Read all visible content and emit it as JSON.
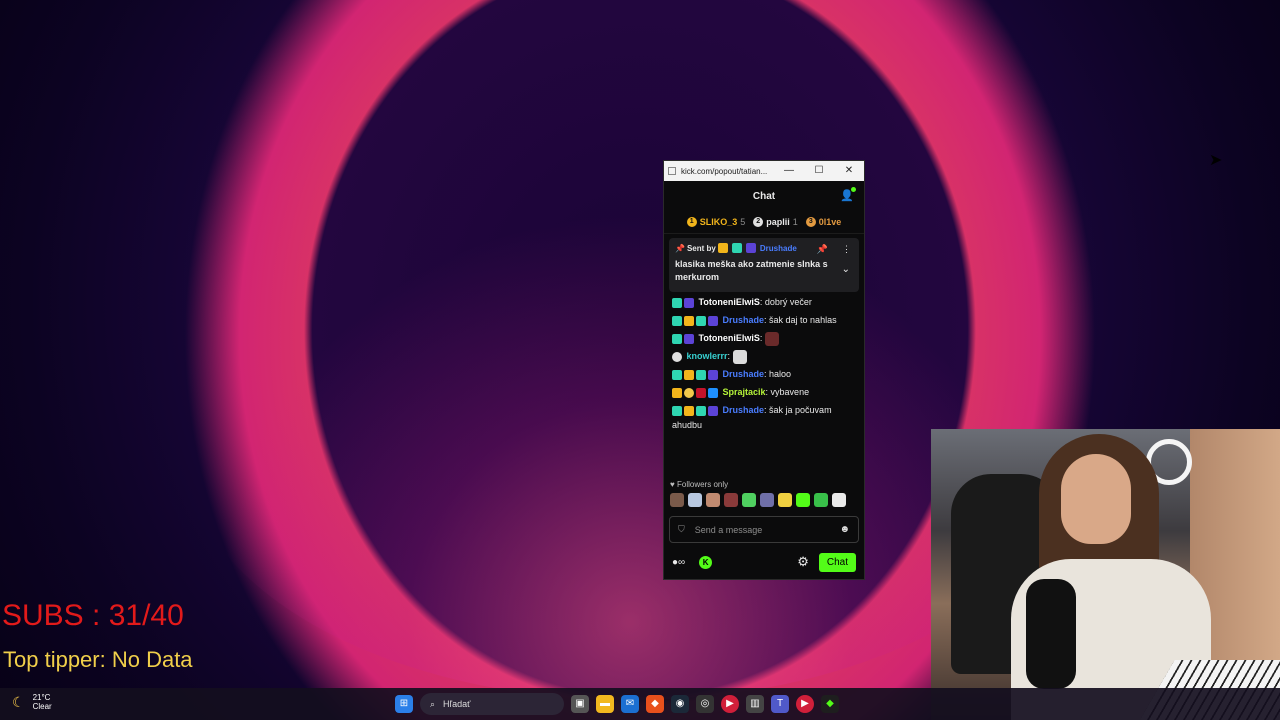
{
  "window": {
    "url": "kick.com/popout/tatian...",
    "minimize": "—",
    "maximize": "☐",
    "close": "✕"
  },
  "chat": {
    "title": "Chat",
    "leaderboard": [
      {
        "rank": "1",
        "name": "SLIKO_3",
        "count": "5",
        "color": "#f2b51b"
      },
      {
        "rank": "2",
        "name": "paplii",
        "count": "1",
        "color": "#e0e0e0"
      },
      {
        "rank": "3",
        "name": "0l1ve",
        "count": "",
        "color": "#e39a40"
      }
    ],
    "pinned": {
      "sent_by": "Sent by",
      "user": "Drushade",
      "message": "klasika meška ako zatmenie slnka s merkurom"
    },
    "messages": [
      {
        "user": "TotoneniElwiS",
        "user_color": "#ffffff",
        "text": ": dobrý večer"
      },
      {
        "user": "Drushade",
        "user_color": "#4a7dff",
        "text": ": šak daj to nahlas"
      },
      {
        "user": "TotoneniElwiS",
        "user_color": "#ffffff",
        "text": ":"
      },
      {
        "user": "knowlerrr",
        "user_color": "#37d0d0",
        "text": ":"
      },
      {
        "user": "Drushade",
        "user_color": "#4a7dff",
        "text": ": haloo"
      },
      {
        "user": "Sprajtacik",
        "user_color": "#b6f53a",
        "text": ": vybavene"
      },
      {
        "user": "Drushade",
        "user_color": "#4a7dff",
        "text": ": šak ja počuvam ahudbu"
      }
    ],
    "followers_only": "Followers only",
    "input_placeholder": "Send a message",
    "send_button": "Chat"
  },
  "overlay": {
    "subs": "SUBS : 31/40",
    "top_tipper": "Top tipper: No Data"
  },
  "taskbar": {
    "temperature": "21°C",
    "condition": "Clear",
    "search_placeholder": "Hľadať"
  }
}
